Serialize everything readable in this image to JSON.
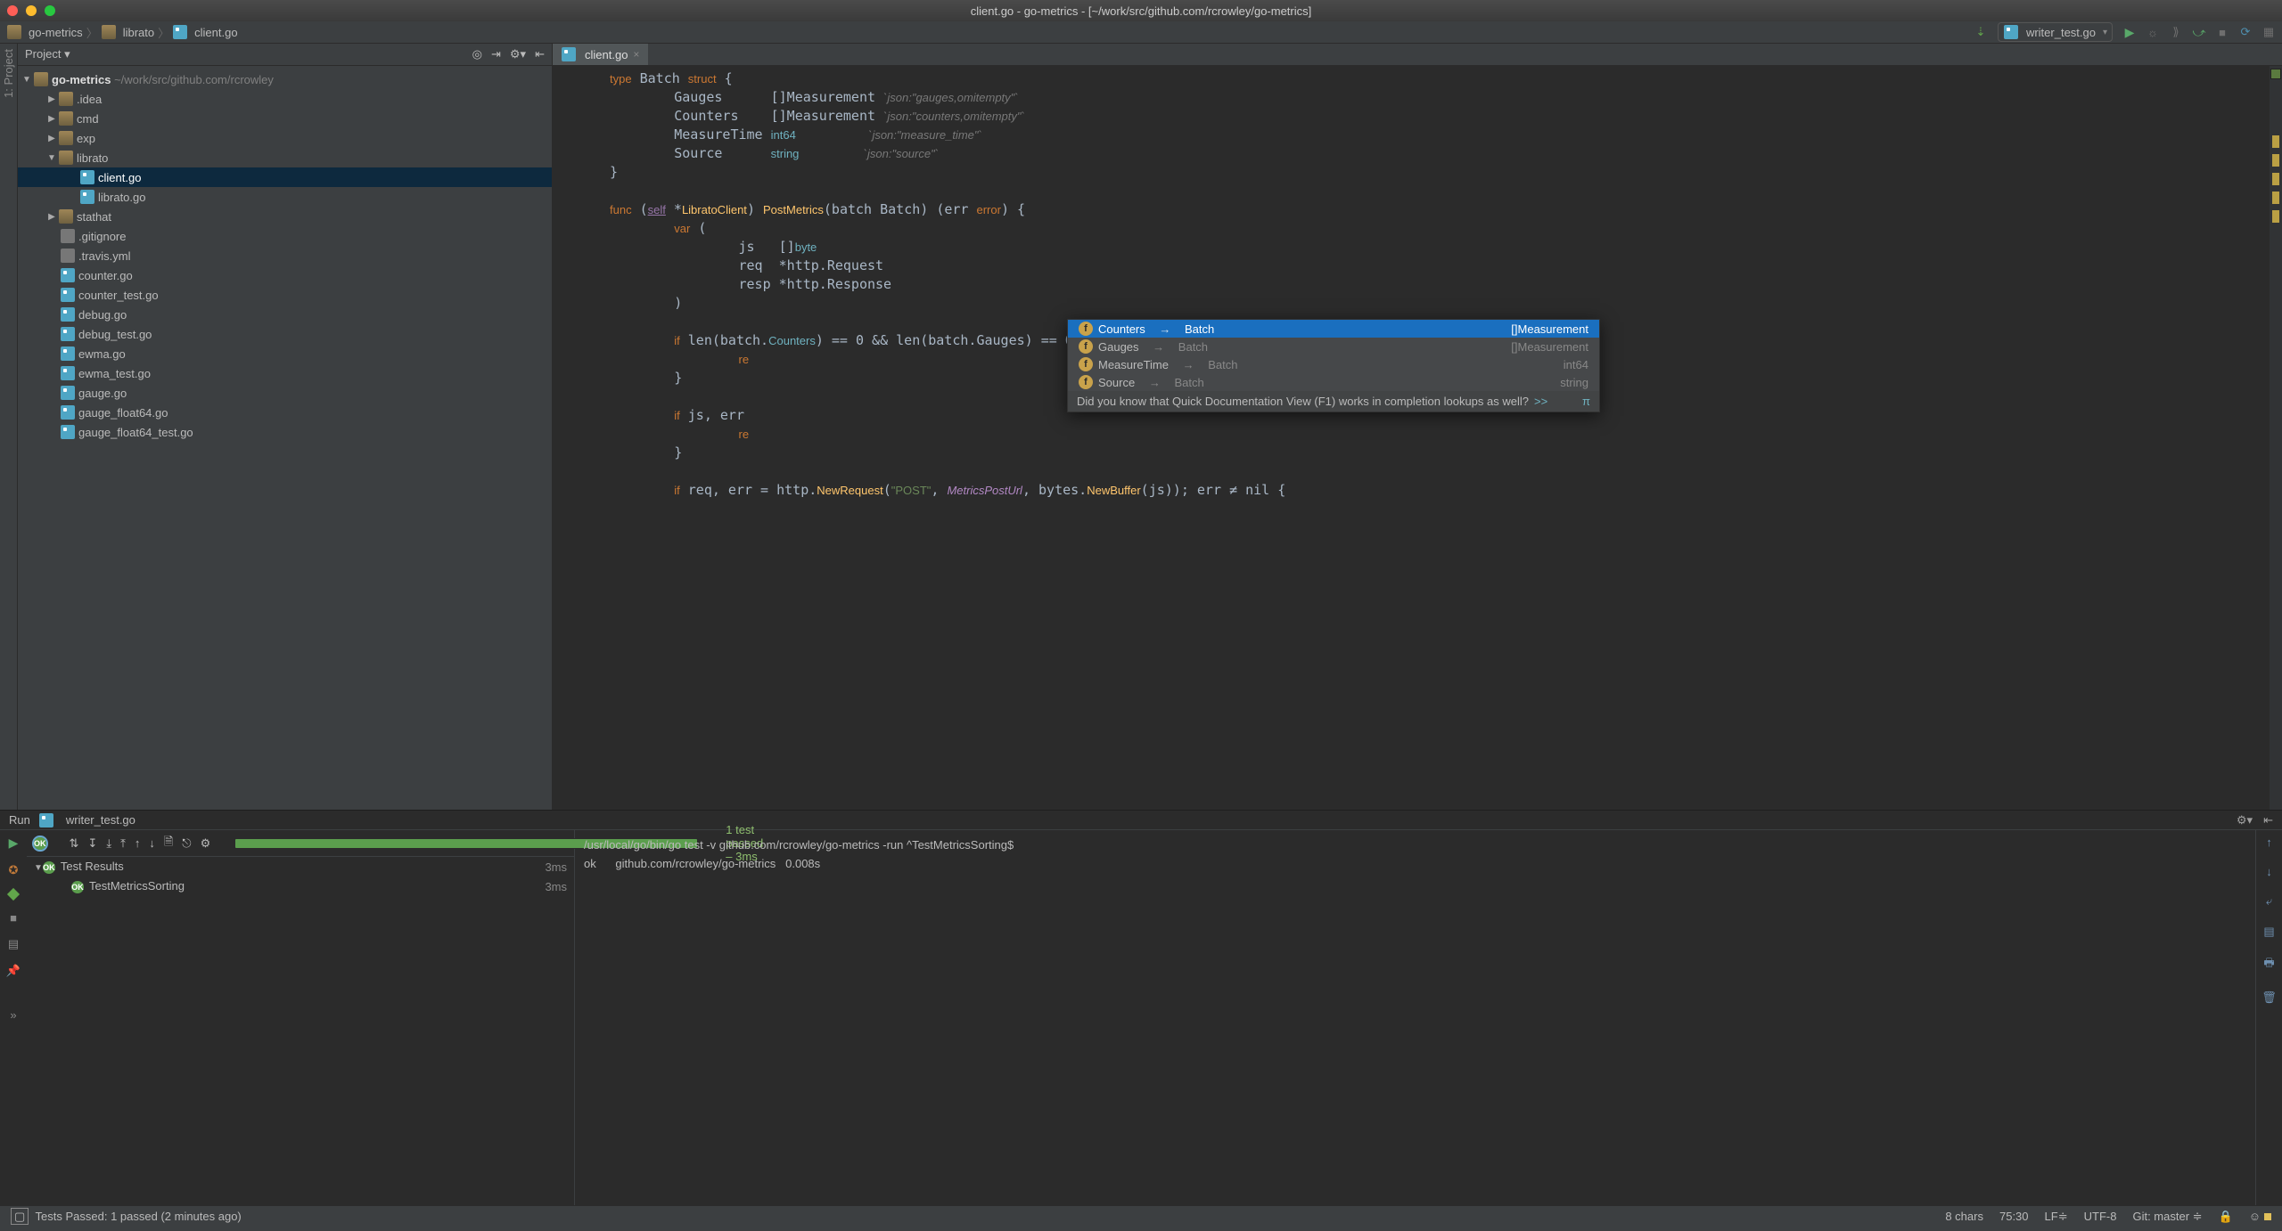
{
  "window_title": "client.go - go-metrics - [~/work/src/github.com/rcrowley/go-metrics]",
  "breadcrumbs": {
    "a": "go-metrics",
    "b": "librato",
    "c": "client.go"
  },
  "run_config_label": "writer_test.go",
  "project": {
    "title": "Project",
    "root": {
      "name": "go-metrics",
      "path": "~/work/src/github.com/rcrowley"
    },
    "items": [
      "​.idea",
      "cmd",
      "exp",
      "librato",
      "client.go",
      "librato.go",
      "stathat",
      ".gitignore",
      ".travis.yml",
      "counter.go",
      "counter_test.go",
      "debug.go",
      "debug_test.go",
      "ewma.go",
      "ewma_test.go",
      "gauge.go",
      "gauge_float64.go",
      "gauge_float64_test.go"
    ]
  },
  "tab_label": "client.go",
  "code_lines": [
    "<span class='kw'>type</span> Batch <span class='kw'>struct</span> {",
    "        Gauges      []Measurement <span class='annot'>`json:\"gauges,omitempty\"`</span>",
    "        Counters    []Measurement <span class='annot'>`json:\"counters,omitempty\"`</span>",
    "        MeasureTime <span class='bt'>int64</span>         <span class='annot'>`json:\"measure_time\"`</span>",
    "        Source      <span class='bt'>string</span>        <span class='annot'>`json:\"source\"`</span>",
    "}",
    "",
    "<span class='kw'>func</span> (<span class='self'>self</span> *<span class='typ'>LibratoClient</span>) <span class='fn'>PostMetrics</span>(batch Batch) (err <span class='errc'>error</span>) {",
    "        <span class='kw'>var</span> (",
    "                js   []<span class='bt'>byte</span>",
    "                req  *http.Request",
    "                resp *http.Response",
    "        )",
    "",
    "        <span class='kw'>if</span> len(batch.<span class='azure'>Counters</span>) == 0 && len(batch.Gauges) == 0 {",
    "                <span class='kw'>re</span>",
    "        }",
    "",
    "        <span class='kw'>if</span> js, err",
    "                <span class='kw'>re</span>",
    "        }",
    "",
    "        <span class='kw'>if</span> req, err = http.<span class='newc'>NewRequest</span>(<span class='str'>\"POST\"</span>, <span class='ident'>MetricsPostUrl</span>, bytes.<span class='newc'>NewBuffer</span>(js)); err ≠ nil {"
  ],
  "popup": {
    "rows": [
      {
        "name": "Counters",
        "of": "Batch",
        "t": "[]Measurement",
        "hl": true
      },
      {
        "name": "Gauges",
        "of": "Batch",
        "t": "[]Measurement"
      },
      {
        "name": "MeasureTime",
        "of": "Batch",
        "t": "int64"
      },
      {
        "name": "Source",
        "of": "Batch",
        "t": "string"
      }
    ],
    "hint": "Did you know that Quick Documentation View (F1) works in completion lookups as well?",
    "hint_more": ">>",
    "hint_pi": "π"
  },
  "run_header": {
    "label": "Run",
    "file": "writer_test.go"
  },
  "tests": {
    "bar_label": "1 test passed – 3ms",
    "root": {
      "name": "Test Results",
      "time": "3ms"
    },
    "child": {
      "name": "TestMetricsSorting",
      "time": "3ms"
    }
  },
  "console": {
    "l1": "/usr/local/go/bin/go test -v github.com/rcrowley/go-metrics -run ^TestMetricsSorting$",
    "l2": "ok      github.com/rcrowley/go-metrics   0.008s"
  },
  "status": {
    "left": "Tests Passed: 1 passed (2 minutes ago)",
    "r1": "8 chars",
    "r2": "75:30",
    "r3": "LF≑",
    "r4": "UTF-8",
    "r5": "Git: master ≑"
  }
}
